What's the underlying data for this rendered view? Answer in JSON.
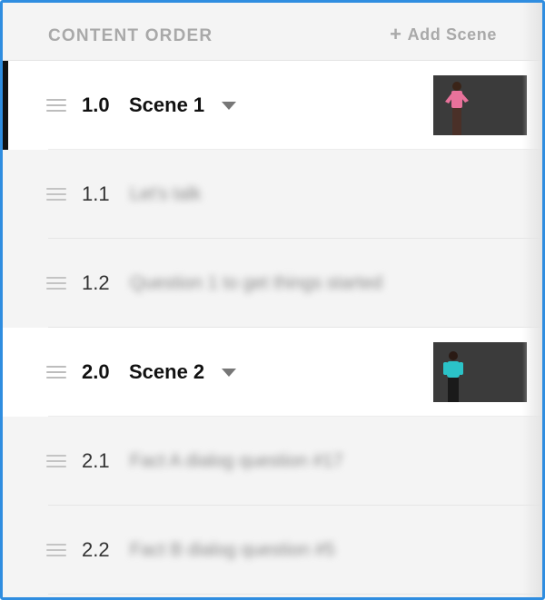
{
  "header": {
    "title": "CONTENT ORDER",
    "add_scene_icon": "plus-icon",
    "add_scene_label": "Add Scene"
  },
  "rows": [
    {
      "type": "scene",
      "number": "1.0",
      "name": "Scene 1",
      "active": true,
      "thumbnail_shirt_color": "#e8729b"
    },
    {
      "type": "item",
      "number": "1.1",
      "text": "Let's talk"
    },
    {
      "type": "item",
      "number": "1.2",
      "text": "Question 1 to get things started"
    },
    {
      "type": "scene",
      "number": "2.0",
      "name": "Scene 2",
      "active": false,
      "thumbnail_shirt_color": "#2bc3c8"
    },
    {
      "type": "item",
      "number": "2.1",
      "text": "Fact A dialog question #17"
    },
    {
      "type": "item",
      "number": "2.2",
      "text": "Fact B dialog question #5"
    }
  ],
  "colors": {
    "frame_border": "#2f8de0",
    "active_indicator": "#111111"
  }
}
